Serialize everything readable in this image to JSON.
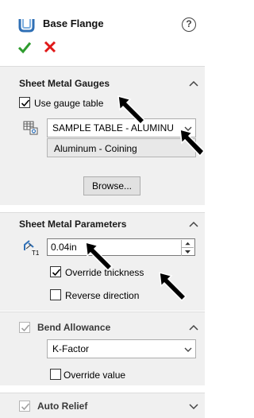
{
  "header": {
    "title": "Base Flange",
    "help_glyph": "?",
    "icons": [
      "base-flange-icon",
      "help-icon",
      "ok-checkmark-icon",
      "cancel-x-icon"
    ],
    "colors": {
      "ok": "#2e9c2e",
      "cancel": "#e01818"
    }
  },
  "gauges": {
    "title": "Sheet Metal Gauges",
    "use_gauge_table_label": "Use gauge table",
    "use_gauge_table_checked": true,
    "table_value": "SAMPLE TABLE - ALUMINU",
    "material_value": "Aluminum - Coining",
    "browse_label": "Browse..."
  },
  "parameters": {
    "title": "Sheet Metal Parameters",
    "thickness_value": "0.04in",
    "thickness_icon_label": "T1",
    "override_thickness_label": "Override thickness",
    "override_thickness_checked": true,
    "reverse_direction_label": "Reverse direction",
    "reverse_direction_checked": false
  },
  "bend": {
    "title": "Bend Allowance",
    "enabled_checked": true,
    "type_value": "K-Factor",
    "override_value_label": "Override value",
    "override_value_checked": false
  },
  "relief": {
    "title": "Auto Relief",
    "enabled_checked": true
  }
}
